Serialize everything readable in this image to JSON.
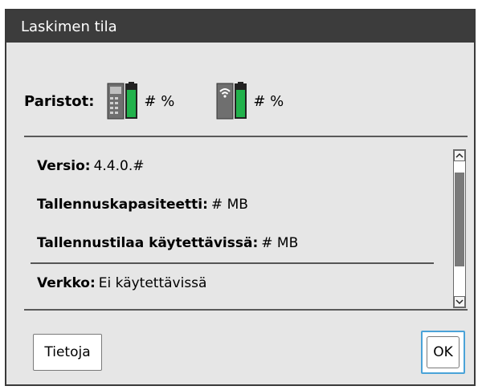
{
  "dialog": {
    "title": "Laskimen tila"
  },
  "battery": {
    "label": "Paristot:",
    "handheld": {
      "icon": "handheld-battery-icon",
      "value": "# %"
    },
    "wireless": {
      "icon": "wireless-battery-icon",
      "value": "# %"
    }
  },
  "info": [
    {
      "label": "Versio:",
      "value": "4.4.0.#"
    },
    {
      "label": "Tallennuskapasiteetti:",
      "value": "# MB"
    },
    {
      "label": "Tallennustilaa käytettävissä:",
      "value": "# MB"
    },
    {
      "label": "Verkko:",
      "value": "Ei käytettävissä"
    }
  ],
  "buttons": {
    "info": "Tietoja",
    "ok": "OK"
  },
  "colors": {
    "titlebar": "#3c3c3c",
    "dialog_bg": "#e6e6e6",
    "battery_green": "#22b24c",
    "focus_ring": "#4aa3d8"
  }
}
